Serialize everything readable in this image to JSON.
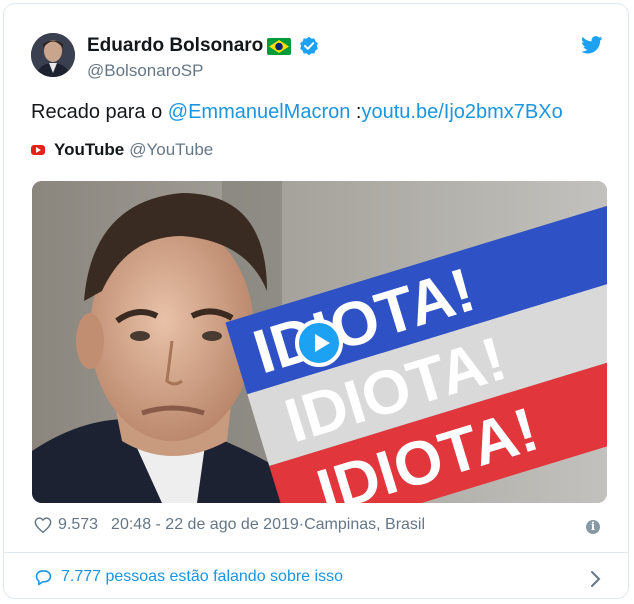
{
  "tweet": {
    "author_name": "Eduardo Bolsonaro",
    "author_handle": "@BolsonaroSP",
    "text_prefix": "Recado para o ",
    "mention": "@EmmanuelMacron",
    "link_sep": " :",
    "link": "youtu.be/Ijo2bmx7BXo"
  },
  "source": {
    "name": "YouTube",
    "handle": "@YouTube"
  },
  "media": {
    "overlay_words": [
      "IDIOTA!",
      "IDIOTA!",
      "IDIOTA!"
    ],
    "band_colors": [
      "#2e52c6",
      "#d9d9d9",
      "#e0363c"
    ]
  },
  "meta": {
    "likes": "9.573",
    "timestamp": "20:48 - 22 de ago de 2019",
    "separator": " · ",
    "location": "Campinas, Brasil",
    "info_icon": "i"
  },
  "footer": {
    "conversation": "7.777 pessoas estão falando sobre isso"
  },
  "icons": [
    "brazil-flag-icon",
    "verified-badge-icon",
    "twitter-bird-icon",
    "youtube-logo-icon",
    "play-icon",
    "heart-icon",
    "info-icon",
    "conversation-icon",
    "chevron-right-icon"
  ],
  "colors": {
    "link": "#1b95e0",
    "twitter_blue": "#1da1f2",
    "muted": "#657786"
  }
}
